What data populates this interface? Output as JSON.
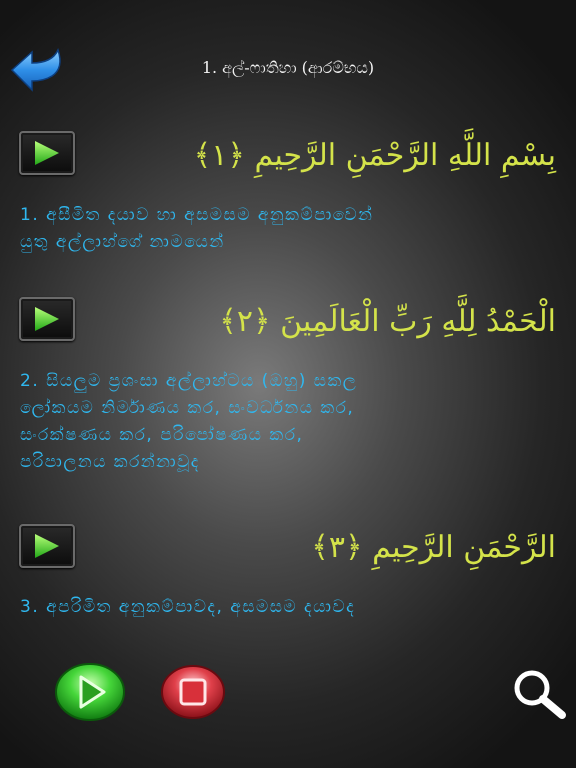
{
  "header": {
    "title": "1. අල්-ෆාතිහා (ආරම්භය)"
  },
  "verses": [
    {
      "arabic": "بِسْمِ اللَّهِ الرَّحْمَنِ الرَّحِيمِ ﴿١﴾",
      "translation_line1": "1. අසීමිත දයාව හා අසමසම අනුකම්පාවෙන්",
      "translation_line2": "යුතු අල්ලාහ්ගේ නාමයෙන්"
    },
    {
      "arabic": "الْحَمْدُ لِلَّهِ رَبِّ الْعَالَمِينَ ﴿٢﴾",
      "translation_line1": "2. සියලුම ප්‍රශංසා අල්ලාහ්ටය (ඔහු) සකල",
      "translation_line2": "ලෝකයම නිර්මාණය කර, සංවර්ධනය කර,",
      "translation_line3": "සංරක්ෂණය කර, පරිපෝෂණය කර,",
      "translation_line4": "පරිපාලනය කරන්නාවූද"
    },
    {
      "arabic": "الرَّحْمَنِ الرَّحِيمِ ﴿٣﴾",
      "translation_line1": "3. අපරිමිත අනුකම්පාවද, අසමසම දයාවද"
    }
  ],
  "colors": {
    "arabic_text": "#d4e34a",
    "translation_text": "#2fb8f0",
    "play_green": "#3fd23a",
    "stop_red": "#e0404a",
    "back_blue": "#2f8fe8"
  },
  "icons": {
    "back": "back-arrow-icon",
    "verse_play": "play-icon",
    "play_all": "play-icon",
    "stop": "stop-icon",
    "zoom": "magnifier-icon"
  }
}
